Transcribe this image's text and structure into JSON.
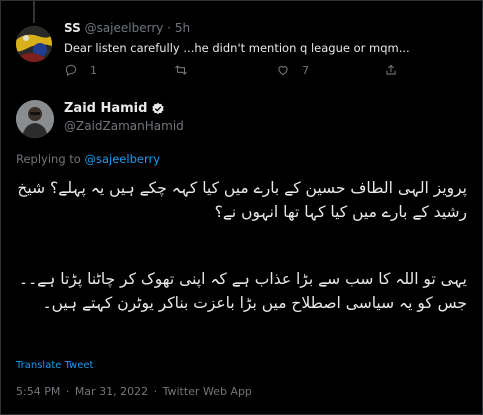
{
  "parent_tweet": {
    "display_name": "SS",
    "handle": "@sajeelberry",
    "separator": "·",
    "time": "5h",
    "text": "Dear listen carefully ...he didn't mention q league or mqm...",
    "actions": {
      "reply_count": "1",
      "retweet_count": "",
      "like_count": "7"
    }
  },
  "main_tweet": {
    "display_name": "Zaid Hamid",
    "handle": "@ZaidZamanHamid",
    "replying_prefix": "Replying to",
    "replying_to": "@sajeelberry",
    "paragraph1": "پرویز الہی الطاف حسین کے بارے میں کیا کہہ چکے ہیں یہ پہلے؟ شیخ رشید کے بارے میں کیا کہا تھا انہوں نے؟",
    "paragraph2": "یہی تو اللہ کا سب سے بڑا عذاب ہے کہ اپنی تھوک کر چاٹنا پڑتا ہے۔۔ جس کو یہ سیاسی اصطلاح میں بڑا باعزت بناکر یوٹرن کہتے ہیں۔",
    "translate_label": "Translate Tweet",
    "time": "5:54 PM",
    "date": "Mar 31, 2022",
    "source": "Twitter Web App",
    "meta_separator": "·"
  },
  "colors": {
    "background": "#000000",
    "text": "#e7e9ea",
    "secondary": "#71767b",
    "link": "#1d9bf0",
    "border": "#2f3336",
    "verified": "#e7e9ea"
  },
  "icons": {
    "reply": "speech-bubble-icon",
    "retweet": "retweet-icon",
    "like": "heart-icon",
    "share": "share-icon",
    "verified": "verified-badge-icon"
  }
}
